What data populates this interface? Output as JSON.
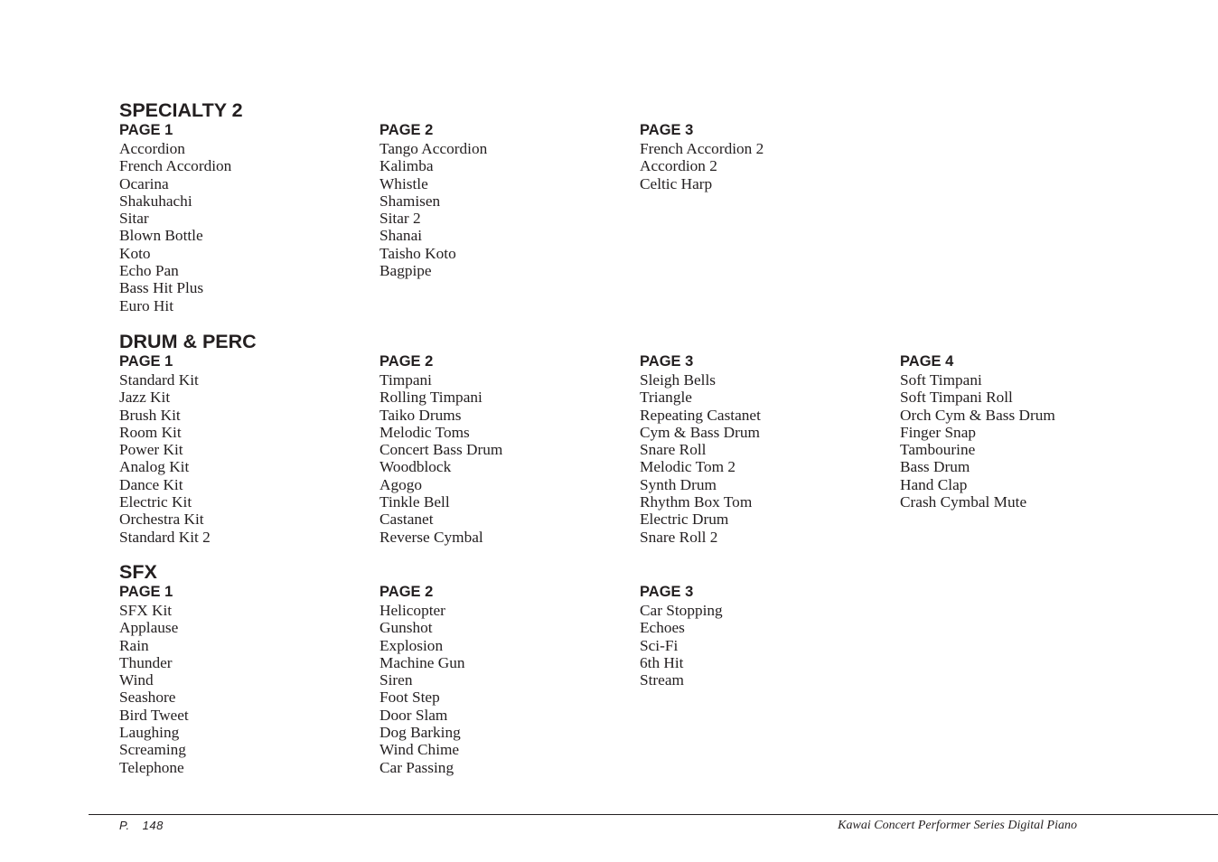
{
  "sections": [
    {
      "title": "SPECIALTY 2",
      "pages": [
        {
          "label": "PAGE 1",
          "items": [
            "Accordion",
            "French Accordion",
            "Ocarina",
            "Shakuhachi",
            "Sitar",
            "Blown Bottle",
            "Koto",
            "Echo Pan",
            "Bass Hit Plus",
            "Euro Hit"
          ]
        },
        {
          "label": "PAGE 2",
          "items": [
            "Tango Accordion",
            "Kalimba",
            "Whistle",
            "Shamisen",
            "Sitar 2",
            "Shanai",
            "Taisho Koto",
            "Bagpipe"
          ]
        },
        {
          "label": "PAGE 3",
          "items": [
            "French Accordion 2",
            "Accordion 2",
            "Celtic Harp"
          ]
        }
      ]
    },
    {
      "title": "DRUM & PERC",
      "pages": [
        {
          "label": "PAGE 1",
          "items": [
            "Standard Kit",
            "Jazz Kit",
            "Brush Kit",
            "Room Kit",
            "Power Kit",
            "Analog Kit",
            "Dance Kit",
            "Electric Kit",
            "Orchestra Kit",
            "Standard Kit 2"
          ]
        },
        {
          "label": "PAGE 2",
          "items": [
            "Timpani",
            "Rolling Timpani",
            "Taiko Drums",
            "Melodic Toms",
            "Concert Bass Drum",
            "Woodblock",
            "Agogo",
            "Tinkle Bell",
            "Castanet",
            "Reverse Cymbal"
          ]
        },
        {
          "label": "PAGE 3",
          "items": [
            "Sleigh Bells",
            "Triangle",
            "Repeating Castanet",
            "Cym & Bass Drum",
            "Snare Roll",
            "Melodic Tom 2",
            "Synth Drum",
            "Rhythm Box Tom",
            "Electric Drum",
            "Snare Roll 2"
          ]
        },
        {
          "label": "PAGE 4",
          "items": [
            "Soft Timpani",
            "Soft Timpani Roll",
            "Orch Cym & Bass Drum",
            "Finger Snap",
            "Tambourine",
            "Bass Drum",
            "Hand Clap",
            "Crash Cymbal Mute"
          ]
        }
      ]
    },
    {
      "title": "SFX",
      "pages": [
        {
          "label": "PAGE 1",
          "items": [
            "SFX Kit",
            "Applause",
            "Rain",
            "Thunder",
            "Wind",
            "Seashore",
            "Bird Tweet",
            "Laughing",
            "Screaming",
            "Telephone"
          ]
        },
        {
          "label": "PAGE 2",
          "items": [
            "Helicopter",
            "Gunshot",
            "Explosion",
            "Machine Gun",
            "Siren",
            "Foot Step",
            "Door Slam",
            "Dog Barking",
            "Wind Chime",
            "Car Passing"
          ]
        },
        {
          "label": "PAGE 3",
          "items": [
            "Car Stopping",
            "Echoes",
            "Sci-Fi",
            "6th Hit",
            "Stream"
          ]
        }
      ]
    }
  ],
  "footer": {
    "page_prefix": "P.",
    "page_number": "148",
    "book_title": "Kawai Concert Performer Series Digital Piano"
  }
}
